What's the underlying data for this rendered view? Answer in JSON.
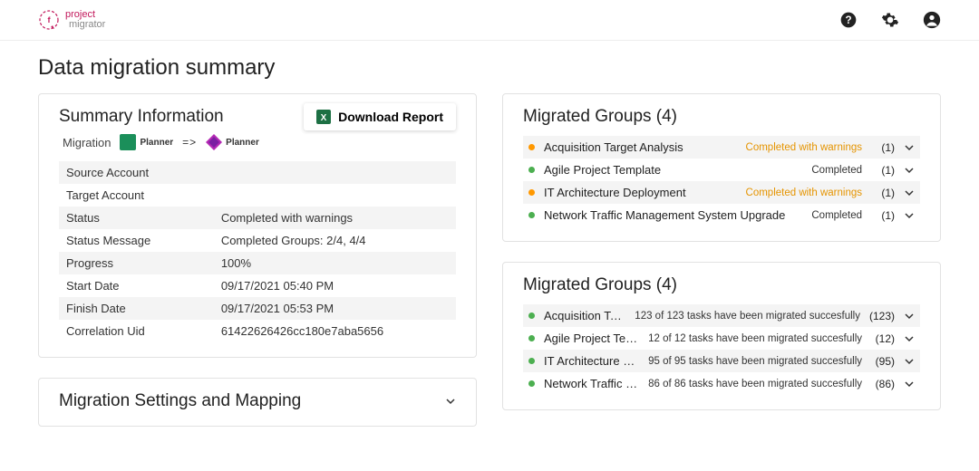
{
  "brand": {
    "l1": "project",
    "l2": "migrator"
  },
  "page_title": "Data migration summary",
  "summary": {
    "title": "Summary Information",
    "download_label": "Download Report",
    "migration_label": "Migration",
    "from_app": "Planner",
    "arrow": "=>",
    "to_app": "Planner",
    "rows": [
      {
        "k": "Source Account",
        "v": ""
      },
      {
        "k": "Target Account",
        "v": ""
      },
      {
        "k": "Status",
        "v": "Completed with warnings"
      },
      {
        "k": "Status Message",
        "v": "Completed Groups: 2/4, 4/4"
      },
      {
        "k": "Progress",
        "v": "100%"
      },
      {
        "k": "Start Date",
        "v": "09/17/2021 05:40 PM"
      },
      {
        "k": "Finish Date",
        "v": "09/17/2021 05:53 PM"
      },
      {
        "k": "Correlation Uid",
        "v": "61422626426cc180e7aba5656"
      }
    ]
  },
  "settings": {
    "title": "Migration Settings and Mapping"
  },
  "groups1": {
    "title": "Migrated Groups (4)",
    "items": [
      {
        "name": "Acquisition Target Analysis",
        "status": "Completed with warnings",
        "warn": true,
        "count": "(1)"
      },
      {
        "name": "Agile Project Template",
        "status": "Completed",
        "warn": false,
        "count": "(1)"
      },
      {
        "name": "IT Architecture Deployment",
        "status": "Completed with warnings",
        "warn": true,
        "count": "(1)"
      },
      {
        "name": "Network Traffic Management System Upgrade",
        "status": "Completed",
        "warn": false,
        "count": "(1)"
      }
    ]
  },
  "groups2": {
    "title": "Migrated Groups (4)",
    "items": [
      {
        "name": "Acquisition Target Analysis",
        "status": "123 of 123 tasks have been migrated succesfully",
        "warn": false,
        "count": "(123)"
      },
      {
        "name": "Agile Project Template",
        "status": "12 of 12 tasks have been migrated succesfully",
        "warn": false,
        "count": "(12)"
      },
      {
        "name": "IT Architecture Deployment",
        "status": "95 of 95 tasks have been migrated succesfully",
        "warn": false,
        "count": "(95)"
      },
      {
        "name": "Network Traffic Management System Upgrade",
        "status": "86 of 86 tasks have been migrated succesfully",
        "warn": false,
        "count": "(86)"
      }
    ]
  }
}
